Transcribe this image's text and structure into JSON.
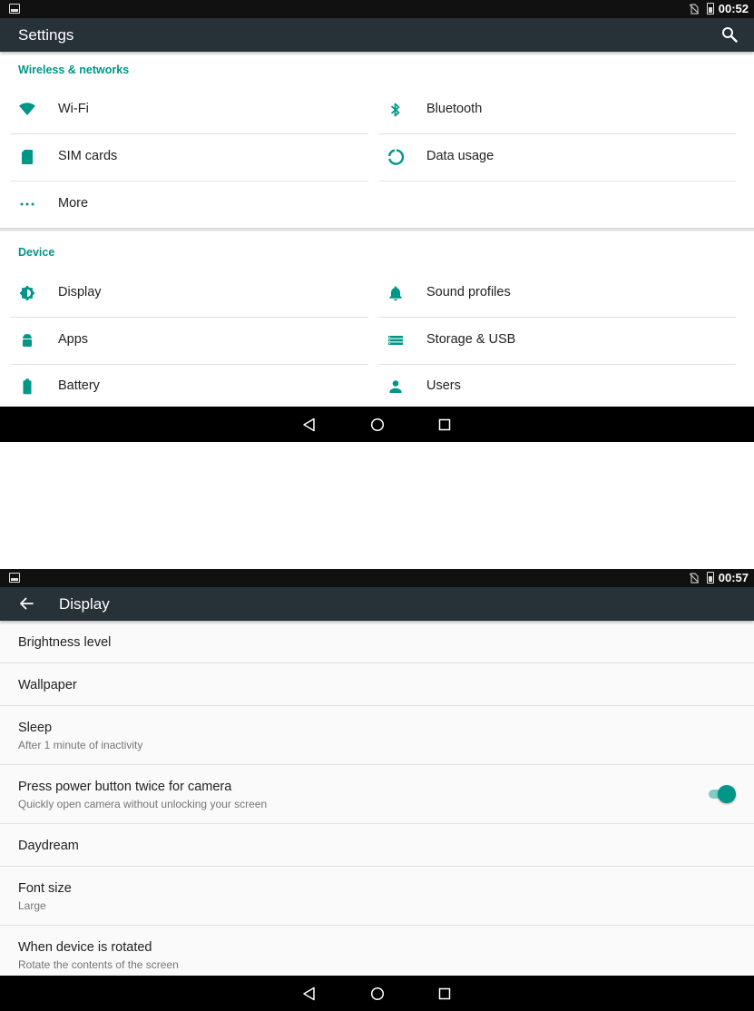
{
  "screen1": {
    "status": {
      "time": "00:52"
    },
    "appbar": {
      "title": "Settings"
    },
    "sections": {
      "wireless": {
        "header": "Wireless & networks",
        "items": [
          {
            "label": "Wi-Fi",
            "icon": "wifi-icon"
          },
          {
            "label": "Bluetooth",
            "icon": "bluetooth-icon"
          },
          {
            "label": "SIM cards",
            "icon": "sim-card-icon"
          },
          {
            "label": "Data usage",
            "icon": "data-usage-icon"
          },
          {
            "label": "More",
            "icon": "more-dots-icon"
          }
        ]
      },
      "device": {
        "header": "Device",
        "items": [
          {
            "label": "Display",
            "icon": "brightness-icon"
          },
          {
            "label": "Sound profiles",
            "icon": "bell-icon"
          },
          {
            "label": "Apps",
            "icon": "android-icon"
          },
          {
            "label": "Storage & USB",
            "icon": "storage-icon"
          },
          {
            "label": "Battery",
            "icon": "battery-icon"
          },
          {
            "label": "Users",
            "icon": "person-icon"
          }
        ]
      }
    }
  },
  "screen2": {
    "status": {
      "time": "00:57"
    },
    "appbar": {
      "title": "Display"
    },
    "prefs": [
      {
        "title": "Brightness level",
        "summary": ""
      },
      {
        "title": "Wallpaper",
        "summary": ""
      },
      {
        "title": "Sleep",
        "summary": "After 1 minute of inactivity"
      },
      {
        "title": "Press power button twice for camera",
        "summary": "Quickly open camera without unlocking your screen",
        "toggle": true
      },
      {
        "title": "Daydream",
        "summary": ""
      },
      {
        "title": "Font size",
        "summary": "Large"
      },
      {
        "title": "When device is rotated",
        "summary": "Rotate the contents of the screen"
      }
    ]
  },
  "colors": {
    "accent": "#009688",
    "appbar": "#263238",
    "statusbar": "#111111",
    "navbar": "#000000"
  }
}
